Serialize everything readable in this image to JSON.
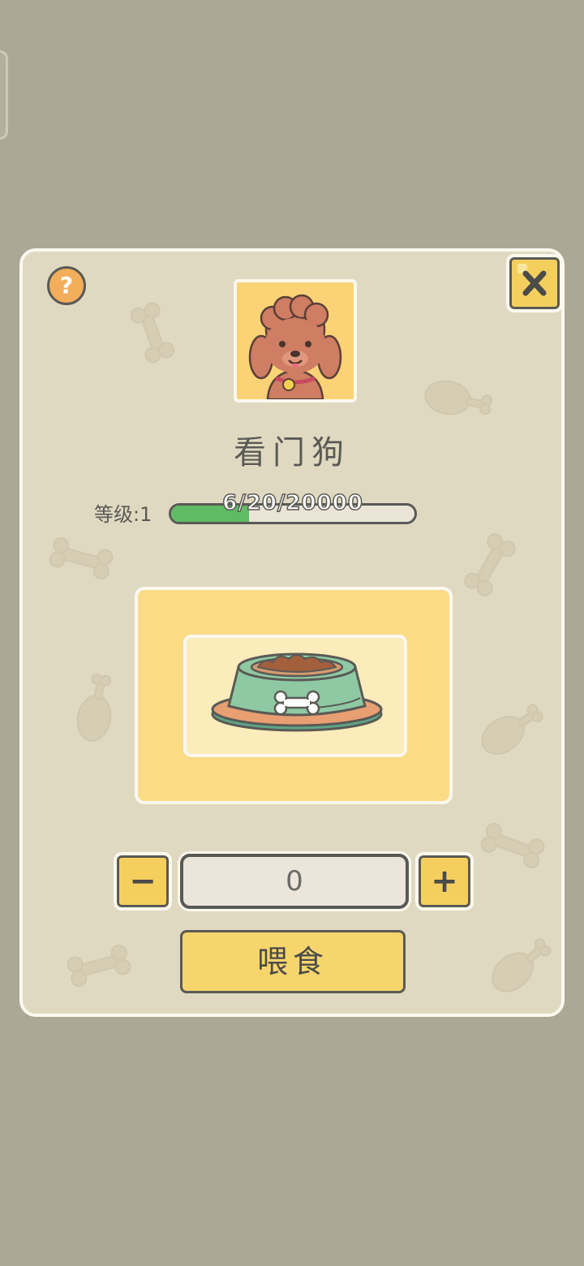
{
  "pet": {
    "name": "看门狗"
  },
  "level": {
    "label": "等级:1",
    "xp_text": "6/20/20000",
    "progress_fraction": 0.32
  },
  "help": {
    "label": "?"
  },
  "quantity": {
    "value": "0",
    "minus_label": "−",
    "plus_label": "+"
  },
  "feed_button": {
    "label": "喂食"
  },
  "colors": {
    "backdrop": "#ada896",
    "modal": "#e0d9c1",
    "accent_yellow": "#f5cf5e",
    "progress_green": "#5fbb64",
    "help_orange": "#f2ae5b",
    "outline": "#5a5a55"
  }
}
